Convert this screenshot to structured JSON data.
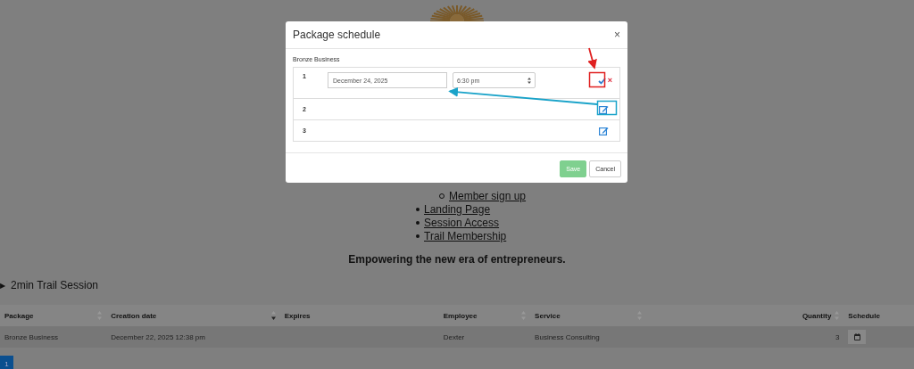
{
  "menu": {
    "items": [
      {
        "label": "Member sign up",
        "kind": "sub"
      },
      {
        "label": "Landing Page",
        "kind": "top"
      },
      {
        "label": "Session Access",
        "kind": "top"
      },
      {
        "label": "Trail Membership",
        "kind": "top"
      }
    ]
  },
  "tagline": "Empowering the new era of entrepreneurs.",
  "details": {
    "marker": "▶",
    "label": "2min Trail Session"
  },
  "table": {
    "columns": [
      {
        "label": "Package",
        "sortable": true,
        "sorted": false
      },
      {
        "label": "Creation date",
        "sortable": true,
        "sorted": true
      },
      {
        "label": "Expires",
        "sortable": false
      },
      {
        "label": "Employee",
        "sortable": true,
        "sorted": false
      },
      {
        "label": "Service",
        "sortable": true,
        "sorted": false
      },
      {
        "label": "Quantity",
        "sortable": true,
        "sorted": false,
        "numeric": true
      },
      {
        "label": "Schedule",
        "sortable": false
      }
    ],
    "rows": [
      {
        "cells": [
          "Bronze Business",
          "December 22, 2025 12:38 pm",
          "",
          "Dexter",
          "Business Consulting",
          "3"
        ]
      }
    ]
  },
  "pagination": [
    {
      "label": "1",
      "selected": true
    }
  ],
  "modal": {
    "title": "Package schedule",
    "close": "×",
    "package": "Bronze Business",
    "rows": [
      {
        "number": "1",
        "kind": "editing",
        "date": "December 24, 2025",
        "time": "6:30 pm"
      },
      {
        "number": "2",
        "kind": "view"
      },
      {
        "number": "3",
        "kind": "view"
      }
    ],
    "buttons": [
      {
        "label": "Save",
        "kind": "primary"
      },
      {
        "label": "Cancel",
        "kind": "default"
      }
    ]
  }
}
